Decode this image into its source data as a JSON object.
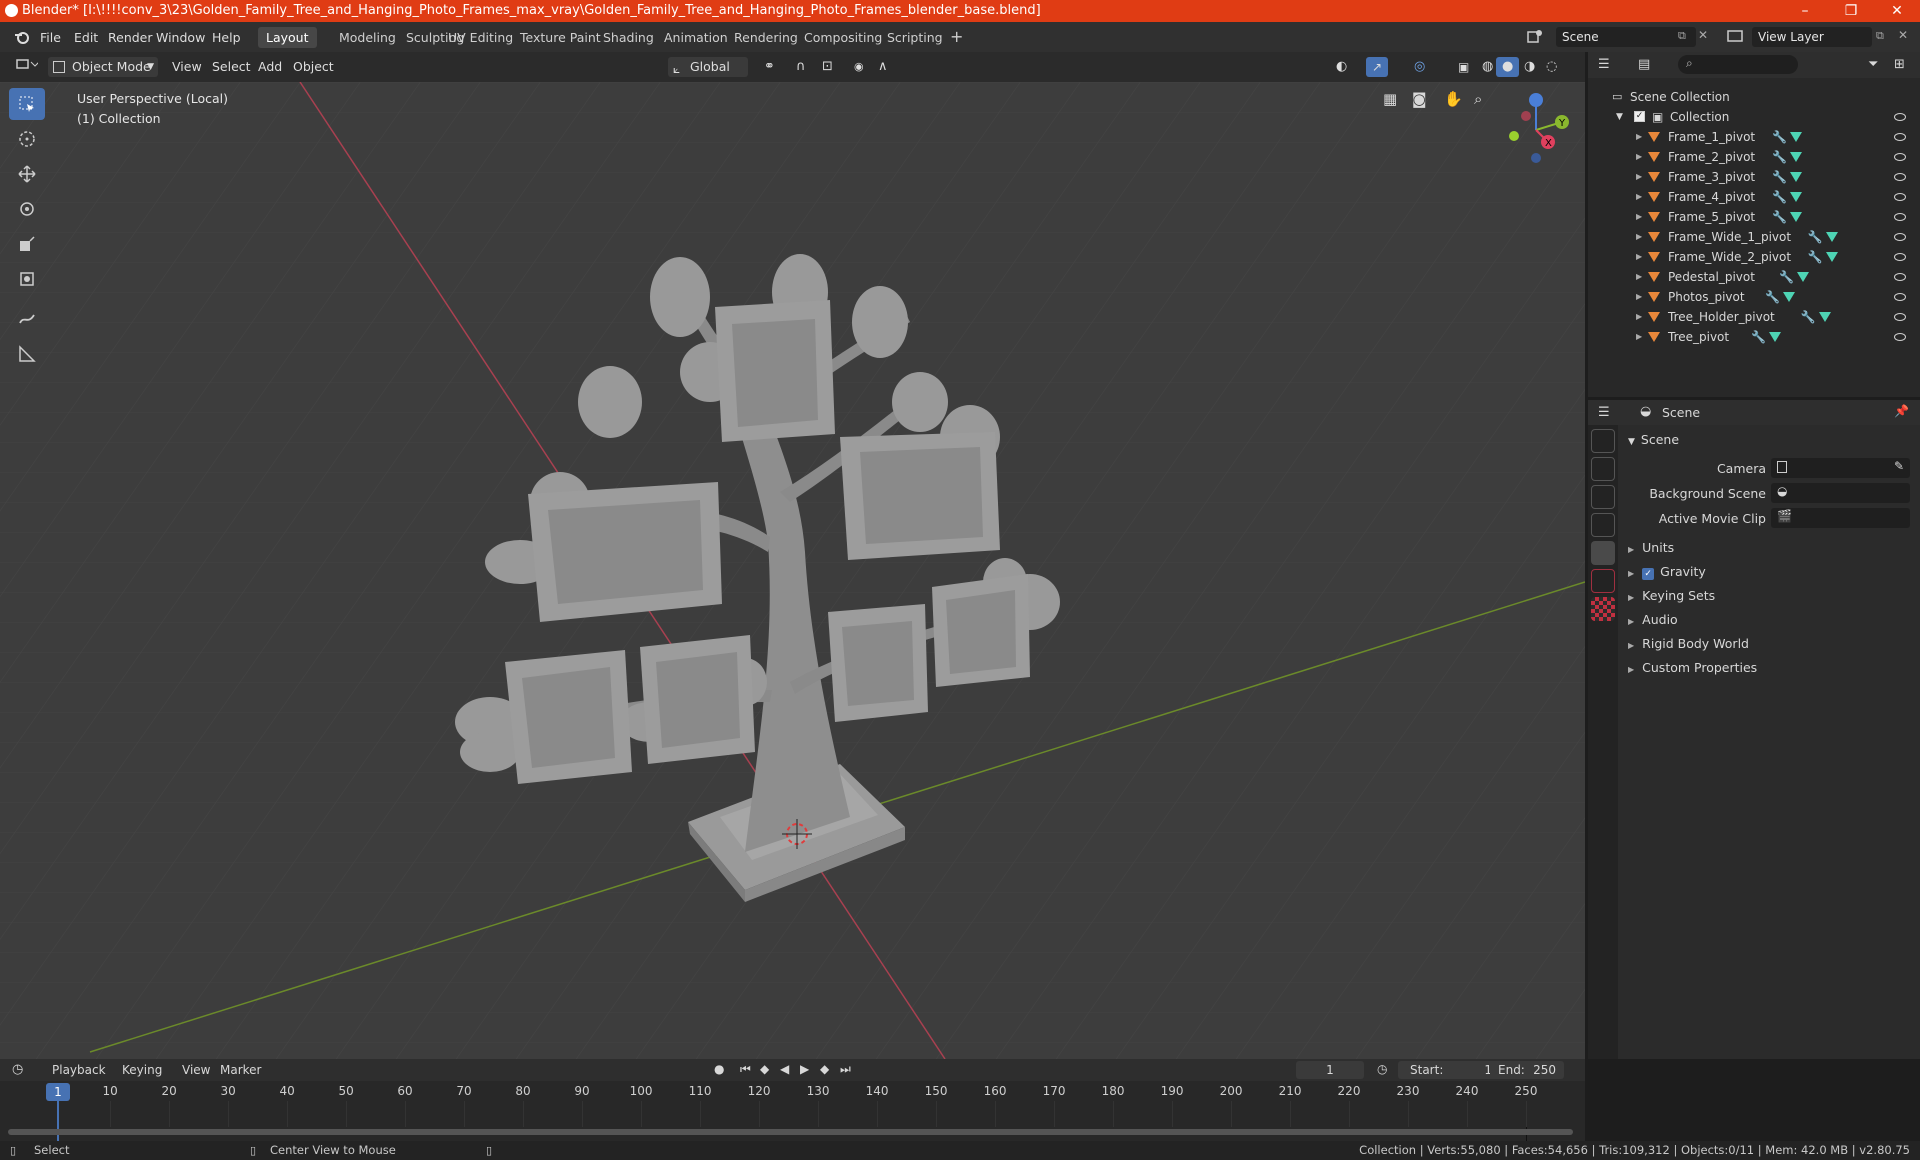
{
  "window": {
    "title": "Blender* [I:\\!!!!conv_3\\23\\Golden_Family_Tree_and_Hanging_Photo_Frames_max_vray\\Golden_Family_Tree_and_Hanging_Photo_Frames_blender_base.blend]",
    "controls": [
      "–",
      "❐",
      "✕"
    ]
  },
  "menubar": {
    "menus": [
      "File",
      "Edit",
      "Render",
      "Window",
      "Help"
    ],
    "workspaces": [
      "Layout",
      "Modeling",
      "Sculpting",
      "UV Editing",
      "Texture Paint",
      "Shading",
      "Animation",
      "Rendering",
      "Compositing",
      "Scripting"
    ],
    "active_workspace": "Layout",
    "add_tab": "+",
    "scene": "Scene",
    "view_layer": "View Layer"
  },
  "viewport_header": {
    "mode": "Object Mode",
    "menus": [
      "View",
      "Select",
      "Add",
      "Object"
    ],
    "transform_orientation": "Global"
  },
  "viewport": {
    "perspective": "User Perspective (Local)",
    "collection": "(1) Collection",
    "gizmo_axes": [
      "Y",
      "X"
    ]
  },
  "outliner": {
    "root": "Scene Collection",
    "collection": "Collection",
    "items": [
      "Frame_1_pivot",
      "Frame_2_pivot",
      "Frame_3_pivot",
      "Frame_4_pivot",
      "Frame_5_pivot",
      "Frame_Wide_1_pivot",
      "Frame_Wide_2_pivot",
      "Pedestal_pivot",
      "Photos_pivot",
      "Tree_Holder_pivot",
      "Tree_pivot"
    ]
  },
  "properties": {
    "header": "Scene",
    "panel": "Scene",
    "fields": [
      {
        "label": "Camera",
        "value": ""
      },
      {
        "label": "Background Scene",
        "value": ""
      },
      {
        "label": "Active Movie Clip",
        "value": ""
      }
    ],
    "sections": [
      "Units",
      "Gravity",
      "Keying Sets",
      "Audio",
      "Rigid Body World",
      "Custom Properties"
    ],
    "gravity_checked": true
  },
  "timeline": {
    "menus": [
      "Playback",
      "Keying",
      "View",
      "Marker"
    ],
    "current_frame": "1",
    "start_label": "Start:",
    "start": "1",
    "end_label": "End:",
    "end": "250",
    "ticks": [
      "10",
      "20",
      "30",
      "40",
      "50",
      "60",
      "70",
      "80",
      "90",
      "100",
      "110",
      "120",
      "130",
      "140",
      "150",
      "160",
      "170",
      "180",
      "190",
      "200",
      "210",
      "220",
      "230",
      "240",
      "250"
    ]
  },
  "statusbar": {
    "left": "Select",
    "middle": "Center View to Mouse",
    "right": "Collection | Verts:55,080 | Faces:54,656 | Tris:109,312 | Objects:0/11 | Mem: 42.0 MB | v2.80.75"
  },
  "colors": {
    "title_bar": "#e03c14",
    "accent": "#4772b3",
    "object_icon": "#e8873a",
    "mesh_icon": "#4ed4b4",
    "x_axis": "#e0405e",
    "y_axis": "#8ab82e",
    "z_axis": "#4a7fd8"
  }
}
